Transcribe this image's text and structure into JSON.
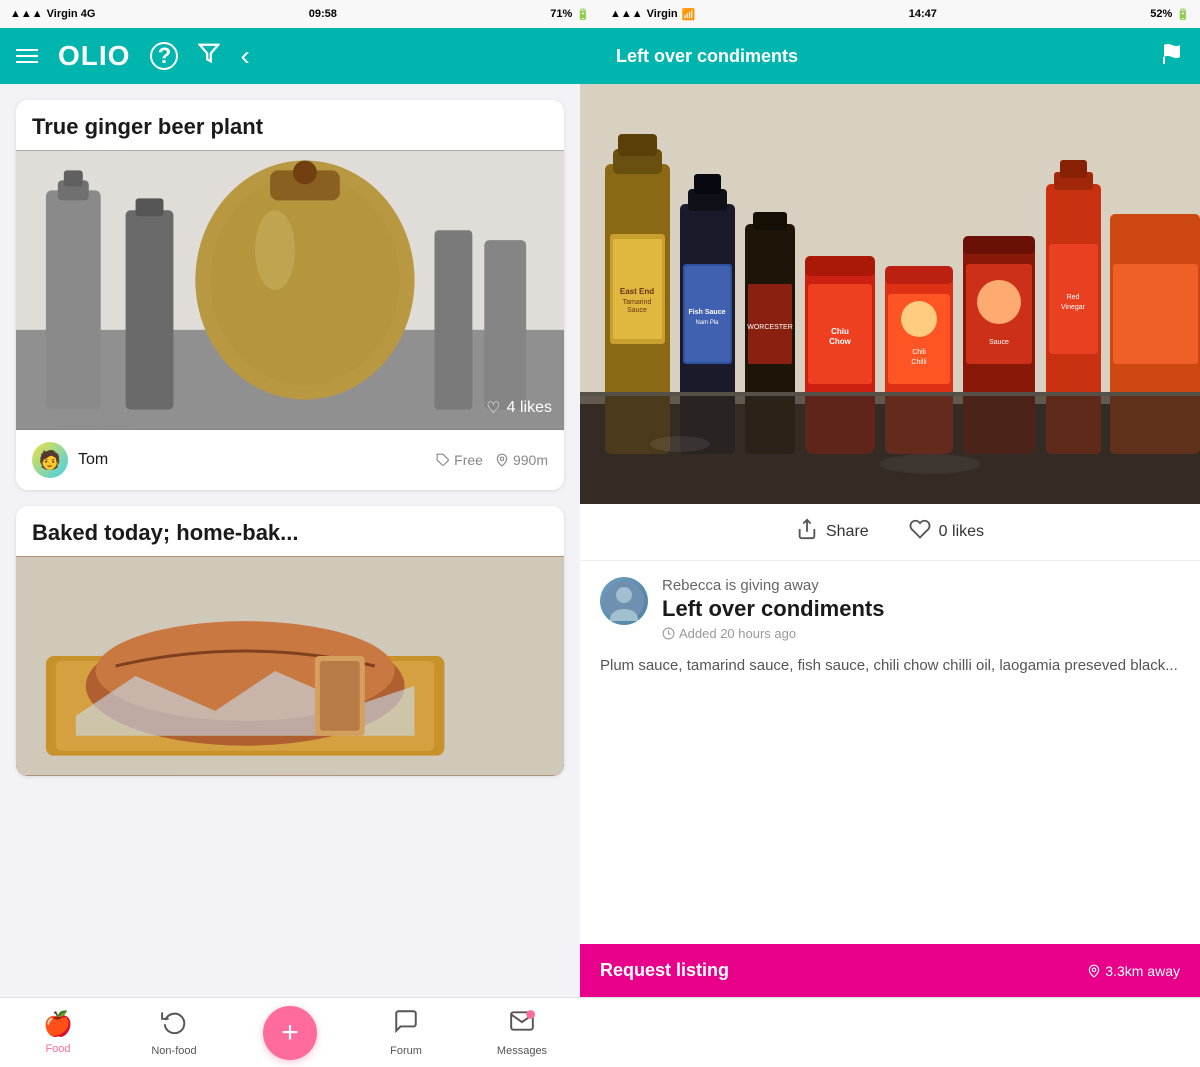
{
  "statusBarLeft": {
    "carrier": "Virgin 4G",
    "signal": "▲▲▲",
    "time": "09:58",
    "battery": "71%"
  },
  "statusBarRight": {
    "time": "14:47",
    "carrier": "Virgin",
    "wifi": "wifi",
    "battery": "52%"
  },
  "headerLeft": {
    "appName": "OLIO",
    "helpIcon": "?",
    "filterIcon": "filter",
    "backIcon": "‹"
  },
  "headerRight": {
    "title": "Left over condiments",
    "flagIcon": "flag"
  },
  "listingCard1": {
    "title": "True ginger beer plant",
    "likes": "4 likes",
    "userName": "Tom",
    "userEmoji": "🧑‍🍳",
    "price": "Free",
    "distance": "990m"
  },
  "listingCard2": {
    "title": "Baked today; home-bak..."
  },
  "detailView": {
    "shareLabel": "Share",
    "likesLabel": "0 likes",
    "givingAway": "Rebecca is giving away",
    "listingTitle": "Left over condiments",
    "timeAgo": "Added 20 hours ago",
    "description": "Plum sauce, tamarind sauce, fish sauce, chili chow chilli oil, laogamia preseved black...",
    "requestLabel": "Request listing",
    "distance": "3.3km away"
  },
  "bottomNav": {
    "items": [
      {
        "id": "food",
        "label": "Food",
        "icon": "🍎",
        "active": true
      },
      {
        "id": "nonfood",
        "label": "Non-food",
        "icon": "♻️",
        "active": false
      },
      {
        "id": "add",
        "label": "+",
        "isAdd": true
      },
      {
        "id": "forum",
        "label": "Forum",
        "icon": "💬",
        "active": false
      },
      {
        "id": "messages",
        "label": "Messages",
        "icon": "✉️",
        "active": false
      }
    ]
  }
}
